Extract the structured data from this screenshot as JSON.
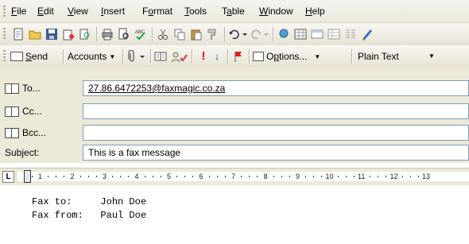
{
  "menubar": {
    "items": [
      {
        "pre": "",
        "u": "F",
        "post": "ile"
      },
      {
        "pre": "",
        "u": "E",
        "post": "dit"
      },
      {
        "pre": "",
        "u": "V",
        "post": "iew"
      },
      {
        "pre": "",
        "u": "I",
        "post": "nsert"
      },
      {
        "pre": "F",
        "u": "o",
        "post": "rmat"
      },
      {
        "pre": "",
        "u": "T",
        "post": "ools"
      },
      {
        "pre": "T",
        "u": "a",
        "post": "ble"
      },
      {
        "pre": "",
        "u": "W",
        "post": "indow"
      },
      {
        "pre": "",
        "u": "H",
        "post": "elp"
      }
    ]
  },
  "toolbar2": {
    "send_pre": "",
    "send_u": "S",
    "send_post": "end",
    "accounts_label": "Accounts",
    "options_pre": "O",
    "options_u": "p",
    "options_post": "tions...",
    "format_value": "Plain Text"
  },
  "fields": {
    "to_label": "To...",
    "to_value": "27.86.6472253@faxmagic.co.za",
    "cc_label": "Cc...",
    "cc_value": "",
    "bcc_label": "Bcc...",
    "bcc_value": "",
    "subject_label": "Subject:",
    "subject_value": "This is a fax message"
  },
  "ruler": {
    "numbers": [
      "1",
      "2",
      "3",
      "4",
      "5",
      "6",
      "7",
      "8",
      "9",
      "10",
      "11",
      "12",
      "13"
    ]
  },
  "body": {
    "lines": [
      "Fax to:     John Doe",
      "Fax from:   Paul Doe"
    ]
  }
}
